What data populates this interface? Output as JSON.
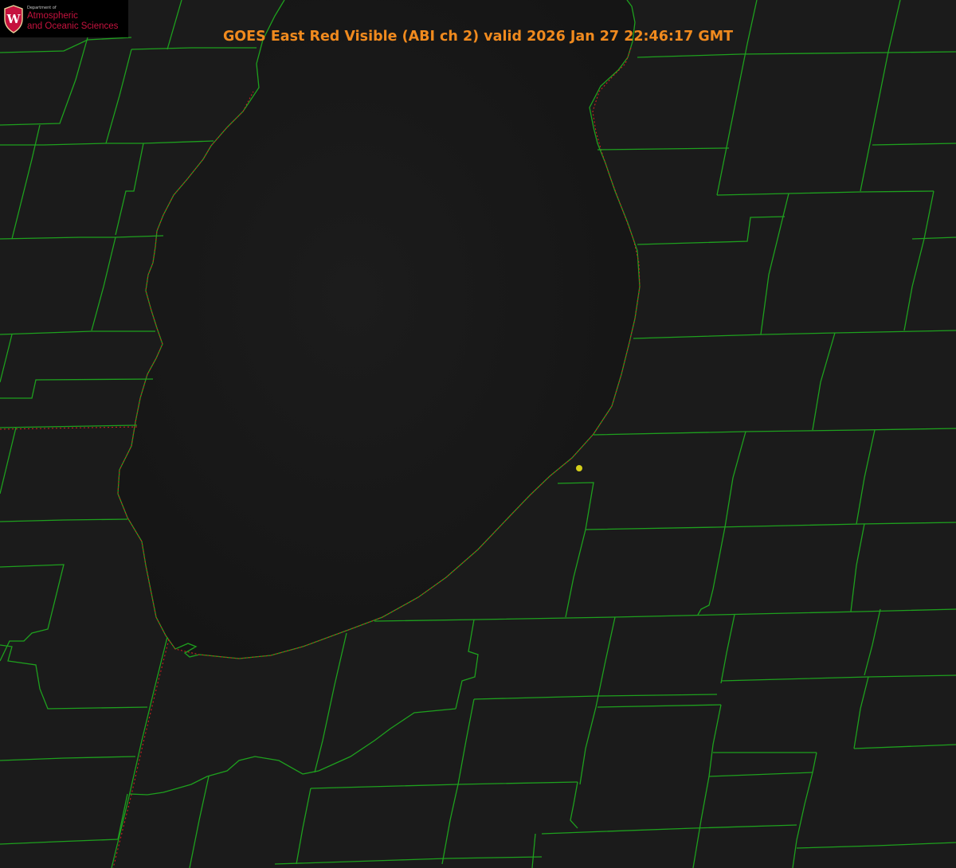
{
  "header": {
    "title": "GOES East Red Visible (ABI ch 2) valid 2026 Jan 27 22:46:17 GMT"
  },
  "logo": {
    "department_line": "Department of",
    "line1": "Atmospheric",
    "line2": "and Oceanic Sciences",
    "crest_letter": "W"
  },
  "map": {
    "product": "GOES East Red Visible (ABI ch 2)",
    "valid_time": "2026 Jan 27 22:46:17 GMT"
  },
  "colors": {
    "title_text": "#f08a1e",
    "county_lines": "#1ea01e",
    "state_border": "#cc2020",
    "shoreline_overlay": "#cc2020",
    "station_marker": "#d4cf1a",
    "logo_text": "#c5123e",
    "crest": "#c5123e",
    "land": "#1b1b1b",
    "lake": "#161616"
  },
  "icons": {
    "crest": "uw-crest-icon",
    "station": "station-marker-icon"
  }
}
